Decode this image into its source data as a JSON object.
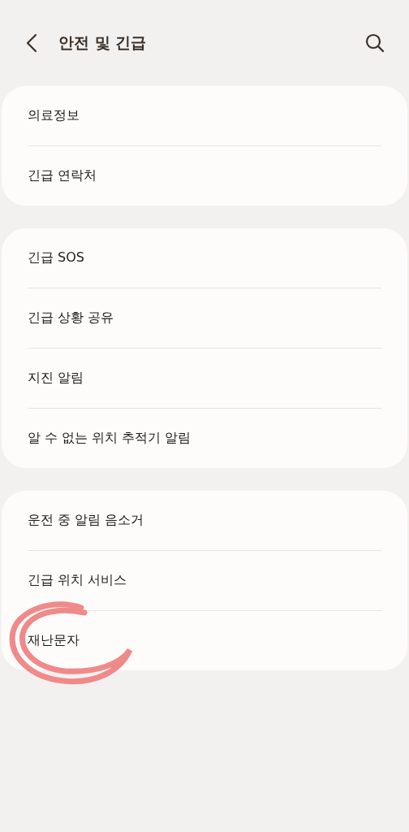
{
  "header": {
    "title": "안전 및 긴급"
  },
  "sections": [
    {
      "items": [
        "의료정보",
        "긴급 연락처"
      ]
    },
    {
      "items": [
        "긴급 SOS",
        "긴급 상황 공유",
        "지진 알림",
        "알 수 없는 위치 추적기 알림"
      ]
    },
    {
      "items": [
        "운전 중 알림 음소거",
        "긴급 위치 서비스",
        "재난문자"
      ]
    }
  ]
}
